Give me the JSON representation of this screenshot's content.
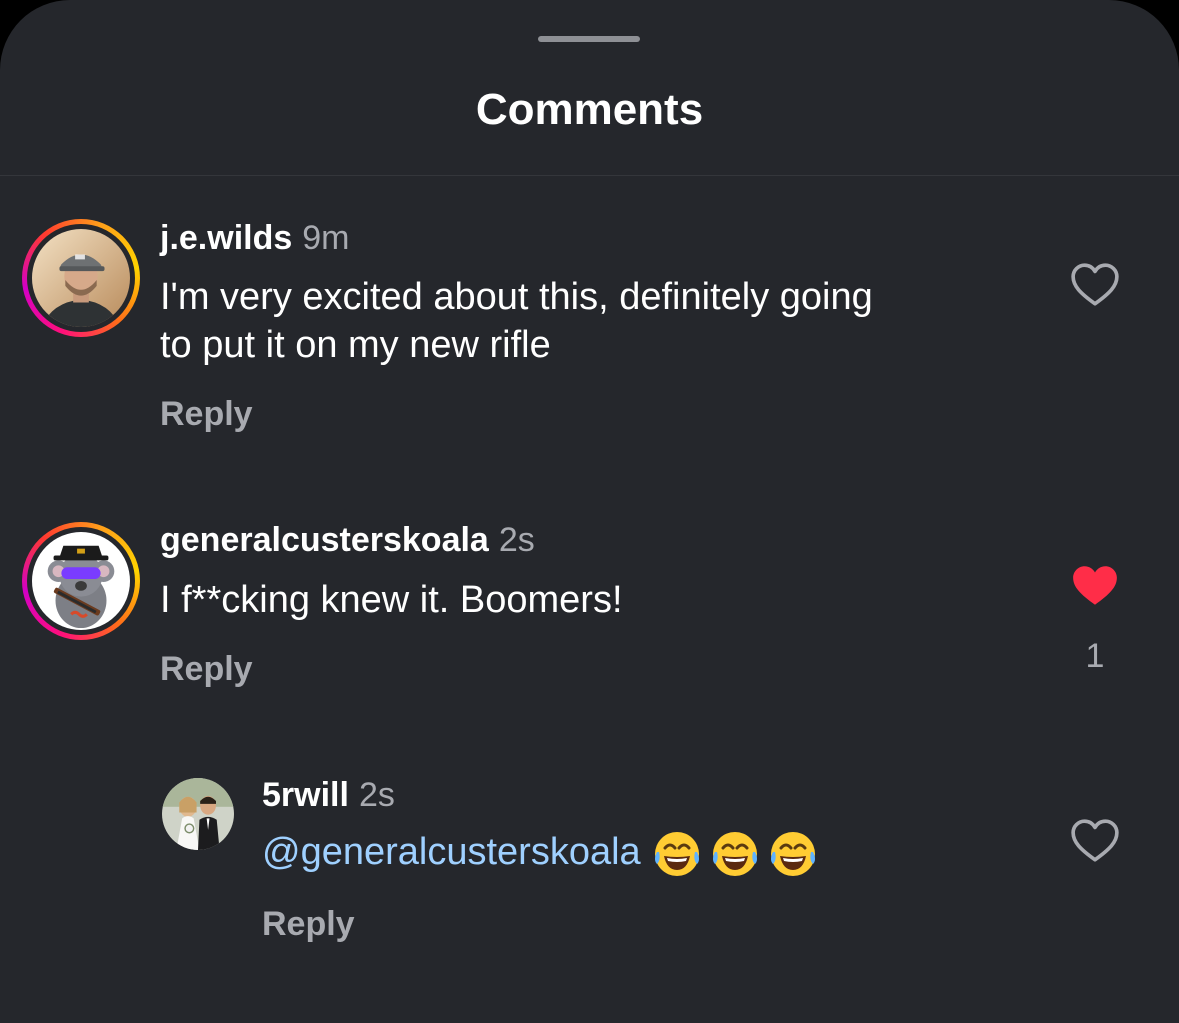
{
  "sheet": {
    "title": "Comments"
  },
  "comments": [
    {
      "username": "j.e.wilds",
      "time": "9m",
      "text_lines": [
        "I'm very excited about this, definitely going",
        "to put it on my new rifle"
      ],
      "reply_label": "Reply",
      "liked": false,
      "avatar": "person-with-cap-avatar"
    },
    {
      "username": "generalcusterskoala",
      "time": "2s",
      "text": "I f**cking knew it. Boomers!",
      "reply_label": "Reply",
      "liked": true,
      "like_count": "1",
      "avatar": "koala-cartoon-avatar"
    },
    {
      "username": "5rwill",
      "time": "2s",
      "mention": "@generalcusterskoala",
      "emojis": [
        "face-with-tears-of-joy",
        "face-with-tears-of-joy",
        "face-with-tears-of-joy"
      ],
      "reply_label": "Reply",
      "liked": false,
      "avatar": "wedding-couple-avatar"
    }
  ],
  "colors": {
    "background": "#25272c",
    "text": "#ffffff",
    "secondary_text": "#a8aab0",
    "mention": "#9fd0ff",
    "like_active": "#ff2d48"
  }
}
